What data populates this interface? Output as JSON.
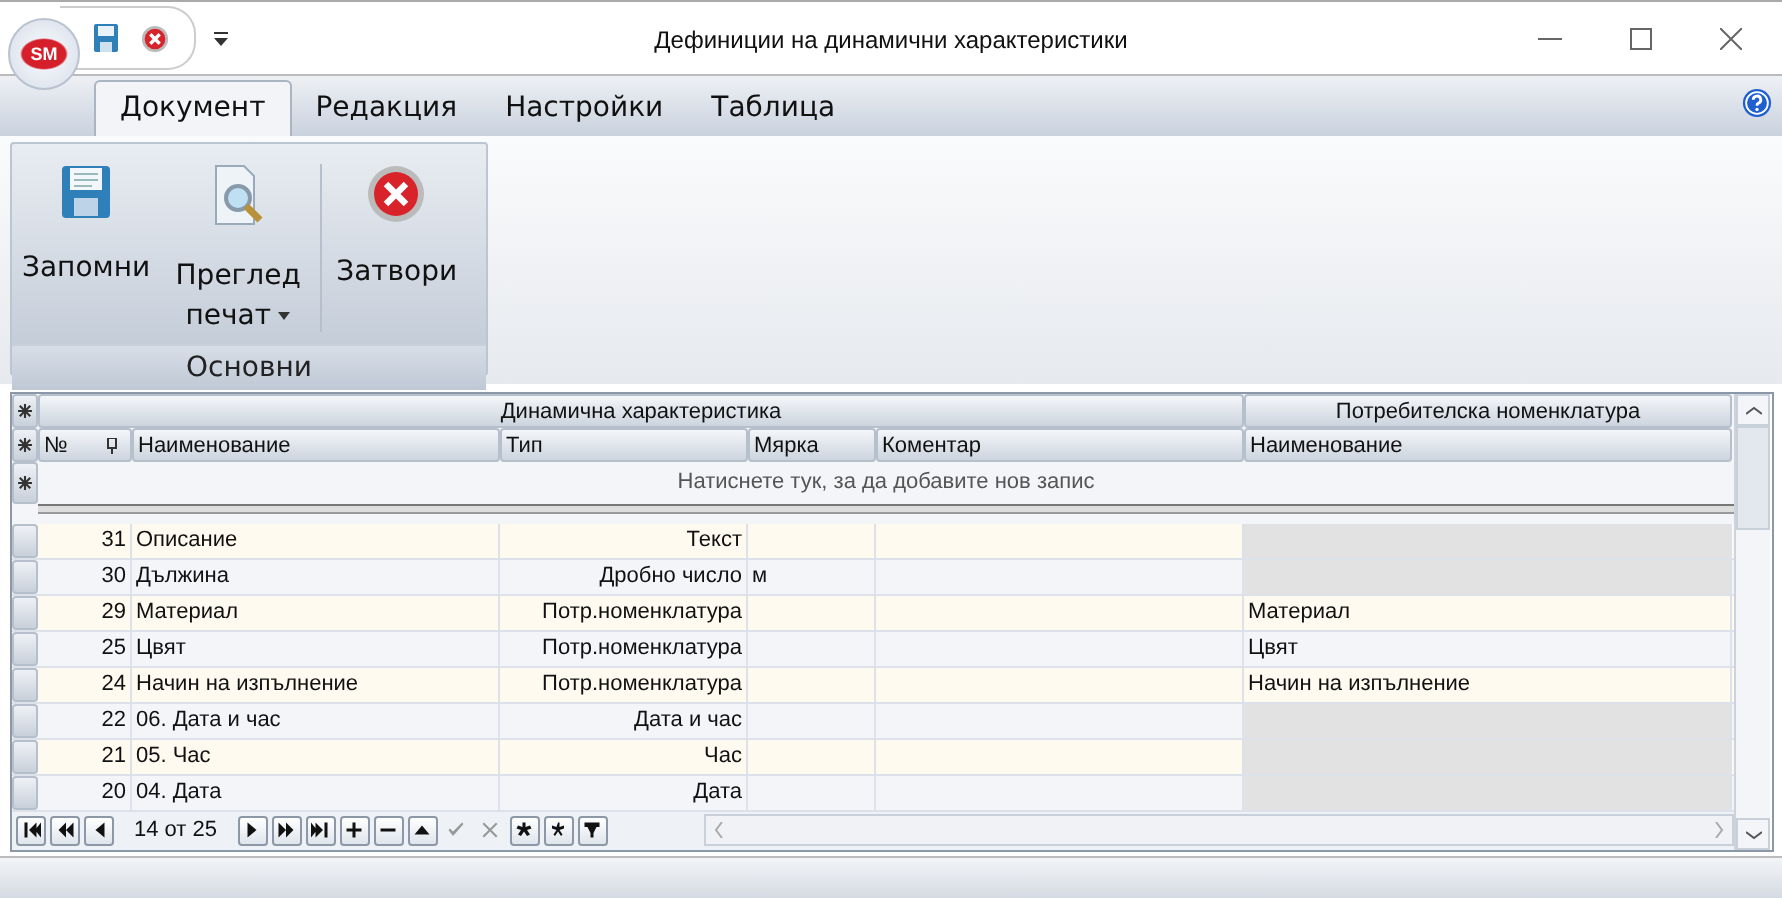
{
  "app_logo": "SM",
  "window": {
    "title": "Дефиниции на динамични характеристики"
  },
  "tabs": [
    {
      "label": "Документ",
      "selected": true
    },
    {
      "label": "Редакция",
      "selected": false
    },
    {
      "label": "Настройки",
      "selected": false
    },
    {
      "label": "Таблица",
      "selected": false
    }
  ],
  "ribbon": {
    "group": "Основни",
    "buttons": [
      {
        "kind": "save",
        "label": "Запомни"
      },
      {
        "kind": "preview",
        "label": "Преглед печат",
        "dropdown": true
      },
      {
        "kind": "close",
        "label": "Затвори"
      }
    ]
  },
  "grid": {
    "bands": [
      "Динамична характеристика",
      "Потребителска номенклатура"
    ],
    "columns": [
      "№",
      "Наименование",
      "Тип",
      "Мярка",
      "Коментар",
      "Наименование"
    ],
    "new_row_hint": "Натиснете тук, за да добавите нов запис",
    "rows": [
      [
        "31",
        "Описание",
        "Текст",
        "",
        "",
        ""
      ],
      [
        "30",
        "Дължина",
        "Дробно число",
        "м",
        "",
        ""
      ],
      [
        "29",
        "Материал",
        "Потр.номенклатура",
        "",
        "",
        "Материал"
      ],
      [
        "25",
        "Цвят",
        "Потр.номенклатура",
        "",
        "",
        "Цвят"
      ],
      [
        "24",
        "Начин на изпълнение",
        "Потр.номенклатура",
        "",
        "",
        "Начин на изпълнение"
      ],
      [
        "22",
        "06. Дата и час",
        "Дата и час",
        "",
        "",
        ""
      ],
      [
        "21",
        "05. Час",
        "Час",
        "",
        "",
        ""
      ],
      [
        "20",
        "04. Дата",
        "Дата",
        "",
        "",
        ""
      ]
    ]
  },
  "navigator": {
    "position": "14 от 25",
    "buttons": [
      {
        "kind": "first",
        "disabled": false
      },
      {
        "kind": "prev-page",
        "disabled": false
      },
      {
        "kind": "prev",
        "disabled": false
      },
      {
        "kind": "next",
        "disabled": false
      },
      {
        "kind": "next-page",
        "disabled": false
      },
      {
        "kind": "last",
        "disabled": false
      },
      {
        "kind": "insert",
        "disabled": false
      },
      {
        "kind": "delete",
        "disabled": false
      },
      {
        "kind": "edit",
        "disabled": false
      },
      {
        "kind": "post",
        "disabled": true
      },
      {
        "kind": "cancel",
        "disabled": true
      },
      {
        "kind": "bookmark",
        "disabled": false
      },
      {
        "kind": "goto-bookmark",
        "disabled": false
      },
      {
        "kind": "filter",
        "disabled": false
      }
    ]
  }
}
